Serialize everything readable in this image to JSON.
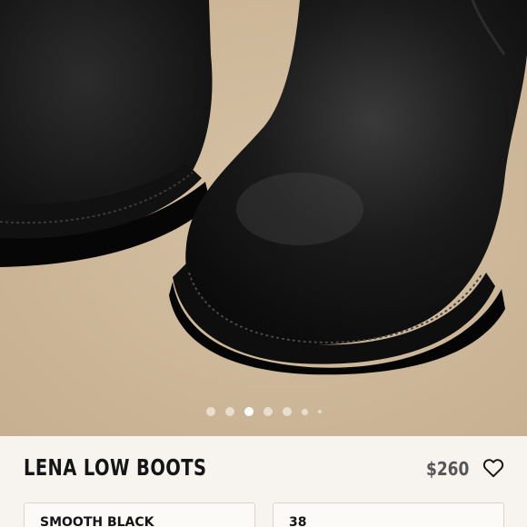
{
  "product": {
    "name": "LENA LOW BOOTS",
    "price": "$260"
  },
  "gallery": {
    "image_count": 7,
    "active_index": 2
  },
  "options": {
    "color_value": "SMOOTH BLACK",
    "size_value": "38"
  },
  "colors": {
    "background": "#f7f4ef",
    "title": "#151515",
    "price": "#555555",
    "dot_active": "#ffffff"
  },
  "icons": {
    "favorite": "heart-outline-icon"
  }
}
